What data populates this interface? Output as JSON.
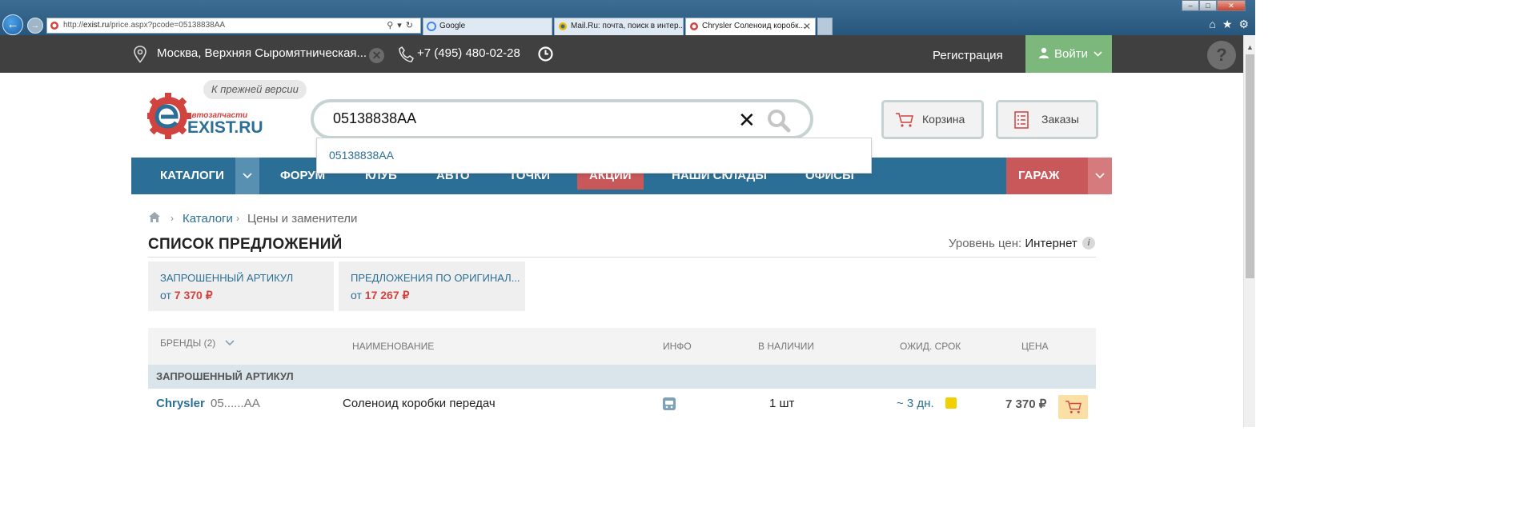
{
  "browser": {
    "url_prefix": "http://",
    "url_host": "exist.ru",
    "url_rest": "/price.aspx?pcode=05138838AA",
    "tabs": [
      {
        "label": "Google"
      },
      {
        "label": "Mail.Ru: почта, поиск в интер..."
      },
      {
        "label": "Chrysler Соленоид коробк...",
        "active": true
      }
    ]
  },
  "topbar": {
    "city": "Москва, Верхняя Сыромятническая...",
    "phone": "+7 (495) 480-02-28",
    "register": "Регистрация",
    "login": "Войти",
    "help": "?"
  },
  "header": {
    "legacy_link": "К прежней версии",
    "logo_top": "автозапчасти",
    "logo_main": "EXIST.RU",
    "search_value": "05138838AA",
    "cart": "Корзина",
    "orders": "Заказы"
  },
  "suggestion": "05138838AA",
  "nav": {
    "catalogs": "КАТАЛОГИ",
    "forum": "ФОРУМ",
    "club": "КЛУБ",
    "auto": "АВТО",
    "points": "ТОЧКИ",
    "actions": "АКЦИИ",
    "warehouses": "НАШИ СКЛАДЫ",
    "offices": "ОФИСЫ",
    "garage": "ГАРАЖ"
  },
  "breadcrumb": {
    "catalogs": "Каталоги",
    "current": "Цены и заменители"
  },
  "page": {
    "title": "СПИСОК ПРЕДЛОЖЕНИЙ",
    "price_level_label": "Уровень цен:",
    "price_level_value": "Интернет",
    "info": "i"
  },
  "offers": [
    {
      "head": "ЗАПРОШЕННЫЙ АРТИКУЛ",
      "from": "от",
      "price": "7 370 ₽"
    },
    {
      "head": "ПРЕДЛОЖЕНИЯ ПО ОРИГИНАЛ...",
      "from": "от",
      "price": "17 267 ₽"
    }
  ],
  "table": {
    "headers": {
      "brands": "БРЕНДЫ (2)",
      "name": "НАИМЕНОВАНИЕ",
      "info": "ИНФО",
      "stock": "В НАЛИЧИИ",
      "eta": "ОЖИД. СРОК",
      "price": "ЦЕНА"
    },
    "group": "ЗАПРОШЕННЫЙ АРТИКУЛ",
    "rows": [
      {
        "brand": "Chrysler",
        "article": "05......AA",
        "name": "Соленоид коробки передач",
        "qty": "1 шт",
        "eta": "~ 3 дн.",
        "price": "7 370 ₽"
      }
    ]
  },
  "colors": {
    "nav_blue": "#2c6f96",
    "accent_red": "#c9585a",
    "login_green": "#7cb87c",
    "price_red": "#d0433f"
  }
}
